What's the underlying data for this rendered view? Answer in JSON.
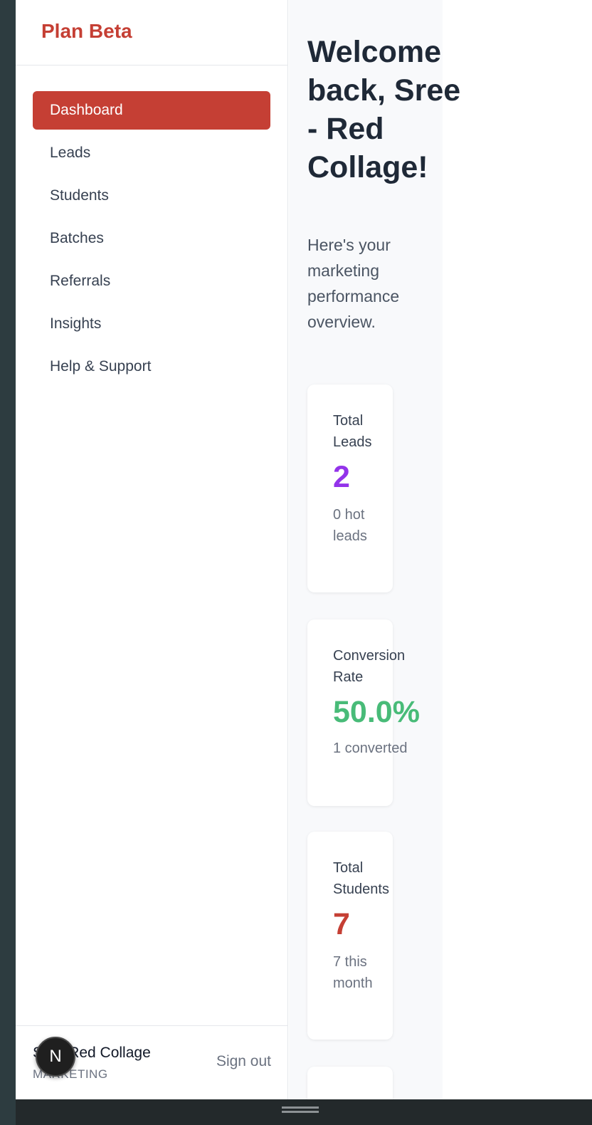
{
  "brand": {
    "title": "Plan Beta"
  },
  "nav": {
    "items": [
      {
        "label": "Dashboard",
        "active": true
      },
      {
        "label": "Leads"
      },
      {
        "label": "Students"
      },
      {
        "label": "Batches"
      },
      {
        "label": "Referrals"
      },
      {
        "label": "Insights"
      },
      {
        "label": "Help & Support"
      }
    ]
  },
  "footer": {
    "user_name": "Sree Red Collage",
    "user_role": "MARKETING",
    "signout_label": "Sign out"
  },
  "main": {
    "welcome": "Welcome back, Sree - Red Collage!",
    "subtitle": "Here's your marketing performance overview.",
    "cards": [
      {
        "label": "Total Leads",
        "value": "2",
        "note": "0 hot leads",
        "color": "#9333ea"
      },
      {
        "label": "Conversion Rate",
        "value": "50.0%",
        "note": "1 converted",
        "color": "#48bb78"
      },
      {
        "label": "Total Students",
        "value": "7",
        "note": "7 this month",
        "color": "#c53f34"
      }
    ]
  },
  "fab": {
    "letter": "N"
  },
  "colors": {
    "accent": "#c53f34",
    "purple": "#9333ea",
    "green": "#48bb78"
  }
}
